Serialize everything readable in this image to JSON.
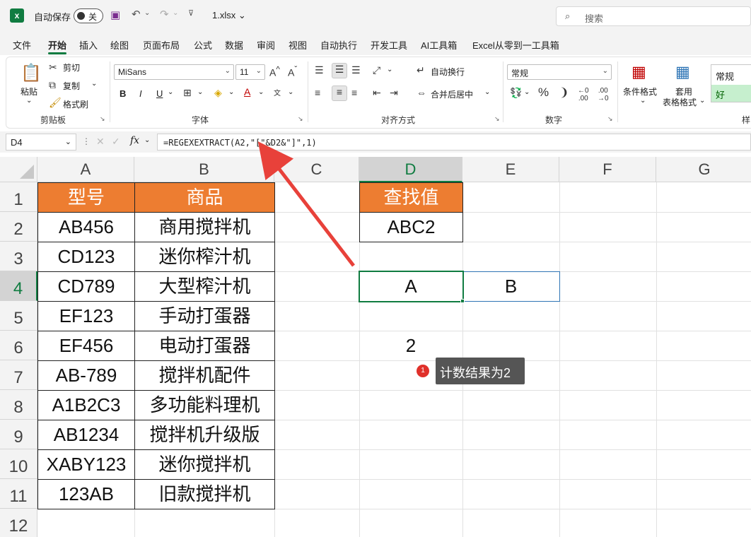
{
  "titlebar": {
    "autosave_label": "自动保存",
    "autosave_state": "关",
    "filename": "1.xlsx",
    "search_placeholder": "搜索"
  },
  "tabs": [
    "文件",
    "开始",
    "插入",
    "绘图",
    "页面布局",
    "公式",
    "数据",
    "审阅",
    "视图",
    "自动执行",
    "开发工具",
    "AI工具箱",
    "Excel从零到一工具箱"
  ],
  "ribbon": {
    "paste": "粘贴",
    "cut": "剪切",
    "copy": "复制",
    "format_painter": "格式刷",
    "clipboard_group": "剪贴板",
    "font_name": "MiSans",
    "font_size": "11",
    "font_group": "字体",
    "bold": "B",
    "italic": "I",
    "underline": "U",
    "wrap_text": "自动换行",
    "merge_center": "合并后居中",
    "alignment_group": "对齐方式",
    "number_format": "常规",
    "number_group": "数字",
    "percent": "%",
    "comma": "❩",
    "conditional_format": "条件格式",
    "table_format_1": "套用",
    "table_format_2": "表格格式",
    "style_normal": "常规",
    "style_good": "好",
    "styles_group": "样"
  },
  "formula_bar": {
    "name_box": "D4",
    "fx": "fx",
    "formula": "=REGEXEXTRACT(A2,\"[\"&D2&\"]\",1)"
  },
  "sheet": {
    "columns": [
      "A",
      "B",
      "C",
      "D",
      "E",
      "F",
      "G"
    ],
    "rows": [
      "1",
      "2",
      "3",
      "4",
      "5",
      "6",
      "7",
      "8",
      "9",
      "10",
      "11",
      "12"
    ],
    "header_a": "型号",
    "header_b": "商品",
    "models": [
      "AB456",
      "CD123",
      "CD789",
      "EF123",
      "EF456",
      "AB-789",
      "A1B2C3",
      "AB1234",
      "XABY123",
      "123AB"
    ],
    "products": [
      "商用搅拌机",
      "迷你榨汁机",
      "大型榨汁机",
      "手动打蛋器",
      "电动打蛋器",
      "搅拌机配件",
      "多功能料理机",
      "搅拌机升级版",
      "迷你搅拌机",
      "旧款搅拌机"
    ],
    "lookup_header": "查找值",
    "lookup_value": "ABC2",
    "d4": "A",
    "e4": "B",
    "d6": "2"
  },
  "annotation": {
    "badge": "1",
    "text": "计数结果为2",
    "arrow_color": "#e8413a"
  },
  "colors": {
    "excel_green": "#107c41",
    "header_orange": "#ed7d31"
  }
}
